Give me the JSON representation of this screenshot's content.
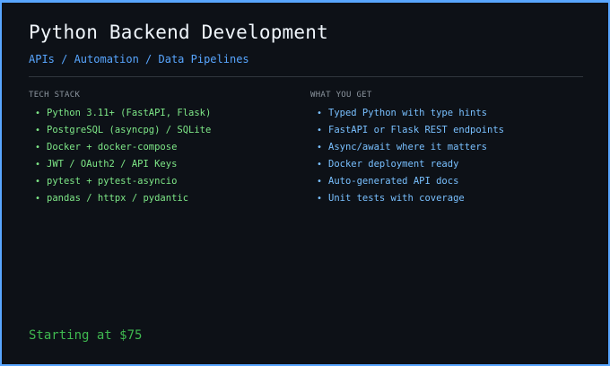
{
  "header": {
    "title": "Python Backend Development",
    "subtitle": "APIs / Automation / Data Pipelines"
  },
  "tech_stack": {
    "heading": "TECH STACK",
    "items": [
      "Python 3.11+ (FastAPI, Flask)",
      "PostgreSQL (asyncpg) / SQLite",
      "Docker + docker-compose",
      "JWT / OAuth2 / API Keys",
      "pytest + pytest-asyncio",
      "pandas / httpx / pydantic"
    ]
  },
  "what_you_get": {
    "heading": "WHAT YOU GET",
    "items": [
      "Typed Python with type hints",
      "FastAPI or Flask REST endpoints",
      "Async/await where it matters",
      "Docker deployment ready",
      "Auto-generated API docs",
      "Unit tests with coverage"
    ]
  },
  "pricing": {
    "text": "Starting at $75"
  },
  "bullet_glyph": "•",
  "colors": {
    "background": "#0d1117",
    "border_accent": "#58a6ff",
    "title": "#f0f6fc",
    "subtitle": "#58a6ff",
    "heading": "#8b949e",
    "tech_item": "#7ee787",
    "benefit_item": "#79c0ff",
    "price": "#3fb950"
  }
}
